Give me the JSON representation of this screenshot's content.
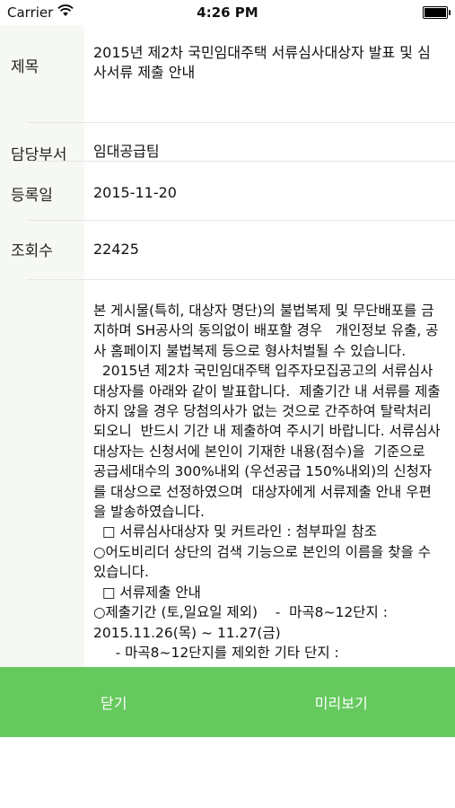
{
  "status_bar": {
    "carrier": "Carrier",
    "time": "4:26 PM"
  },
  "fields": {
    "title_label": "제목",
    "title_value": "2015년 제2차 국민임대주택 서류심사대상자 발표 및 심사서류 제출 안내",
    "dept_label": "담당부서",
    "dept_value": "임대공급팀",
    "date_label": "등록일",
    "date_value": "2015-11-20",
    "views_label": "조회수",
    "views_value": "22425"
  },
  "body": {
    "text": "본 게시물(특히, 대상자 명단)의 불법복제 및 무단배포를 금지하며 SH공사의 동의없이 배포할 경우   개인정보 유출, 공사 홈페이지 불법복제 등으로 형사처벌될 수 있습니다.\n  2015년 제2차 국민임대주택 입주자모집공고의 서류심사대상자를 아래와 같이 발표합니다.  제출기간 내 서류를 제출하지 않을 경우 당첨의사가 없는 것으로 간주하여 탈락처리 되오니  반드시 기간 내 제출하여 주시기 바랍니다. 서류심사대상자는 신청서에 본인이 기재한 내용(점수)을  기준으로 공급세대수의 300%내외 (우선공급 150%내외)의 신청자를 대상으로 선정하였으며  대상자에게 서류제출 안내 우편을 발송하였습니다.\n  □ 서류심사대상자 및 커트라인 : 첨부파일 참조\n○어도비리더 상단의 검색 기능으로 본인의 이름을 찾을 수 있습니다.\n  □ 서류제출 안내\n○제출기간 (토,일요일 제외)    -  마곡8~12단지 : 2015.11.26(목) ~ 11.27(금)\n     - 마곡8~12단지를 제외한 기타 단지 :"
  },
  "bottom_bar": {
    "close_label": "닫기",
    "preview_label": "미리보기",
    "color": "#66c95e"
  }
}
